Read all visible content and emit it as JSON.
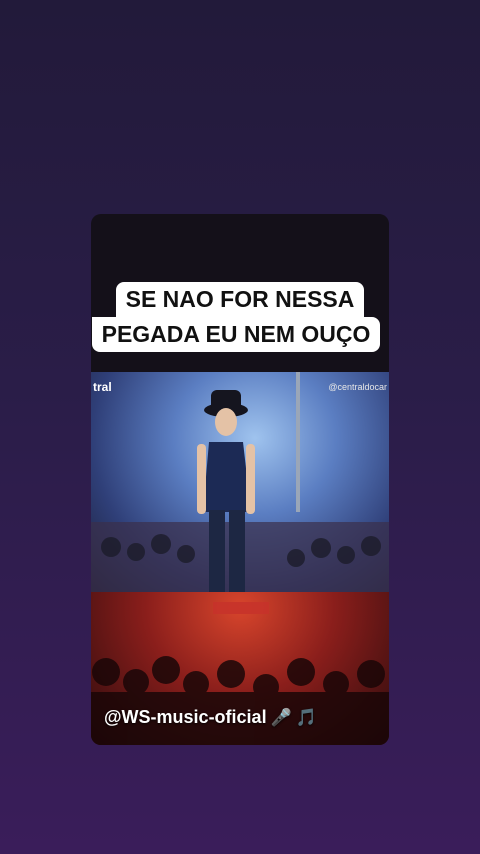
{
  "caption": {
    "line1": "SE NAO FOR NESSA",
    "line2": "PEGADA EU NEM OUÇO"
  },
  "watermarks": {
    "left": "tral",
    "right": "@centraldocar"
  },
  "overlay": {
    "handle": "@WS-music-oficial",
    "icons": [
      "microphone-icon",
      "music-note-icon"
    ]
  },
  "colors": {
    "background": "#2a1d48",
    "caption_bg": "#ffffff",
    "caption_text": "#111111"
  }
}
